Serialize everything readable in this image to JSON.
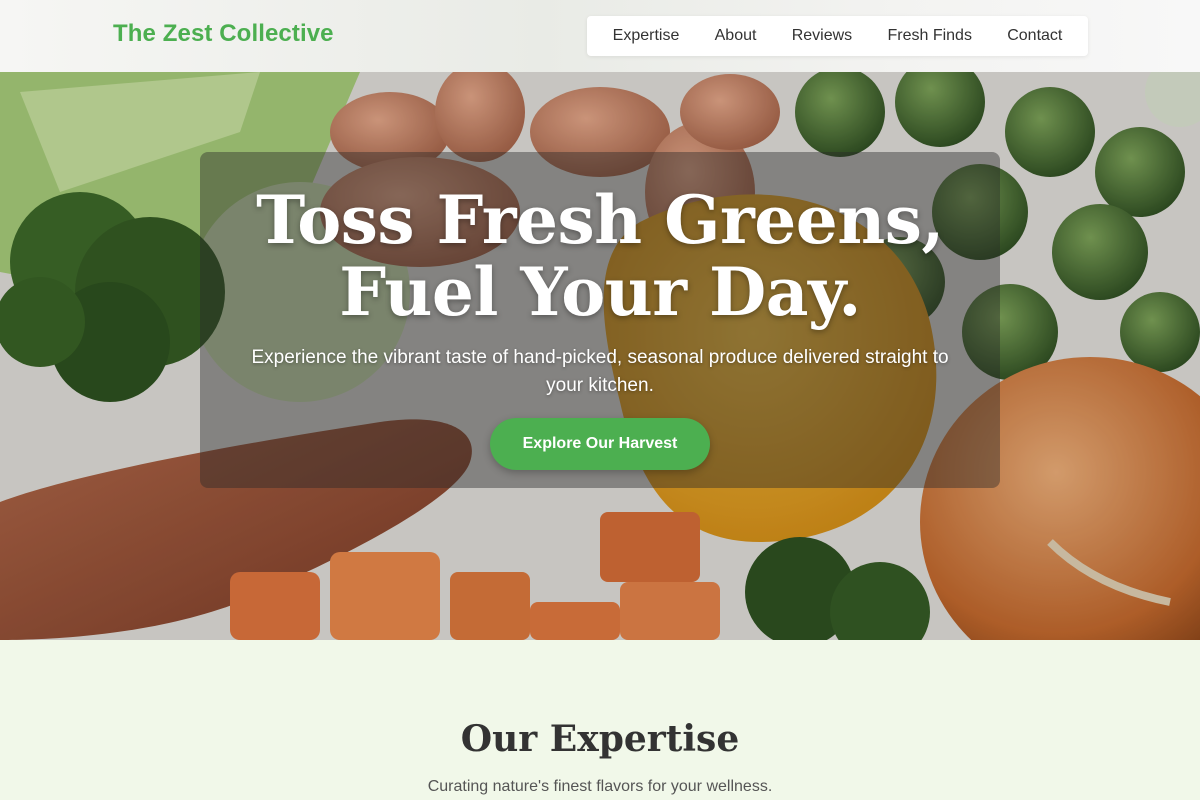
{
  "brand": {
    "name": "The Zest Collective",
    "color": "#4caf50"
  },
  "nav": {
    "items": [
      {
        "label": "Expertise"
      },
      {
        "label": "About"
      },
      {
        "label": "Reviews"
      },
      {
        "label": "Fresh Finds"
      },
      {
        "label": "Contact"
      }
    ]
  },
  "hero": {
    "title": "Toss Fresh Greens, Fuel Your Day.",
    "subtitle": "Experience the vibrant taste of hand-picked, seasonal produce delivered straight to your kitchen.",
    "cta_label": "Explore Our Harvest"
  },
  "expertise": {
    "title": "Our Expertise",
    "subtitle": "Curating nature's finest flavors for your wellness."
  },
  "colors": {
    "accent": "#4caf50",
    "section_bg": "#f1f8e9",
    "text": "#333333"
  }
}
